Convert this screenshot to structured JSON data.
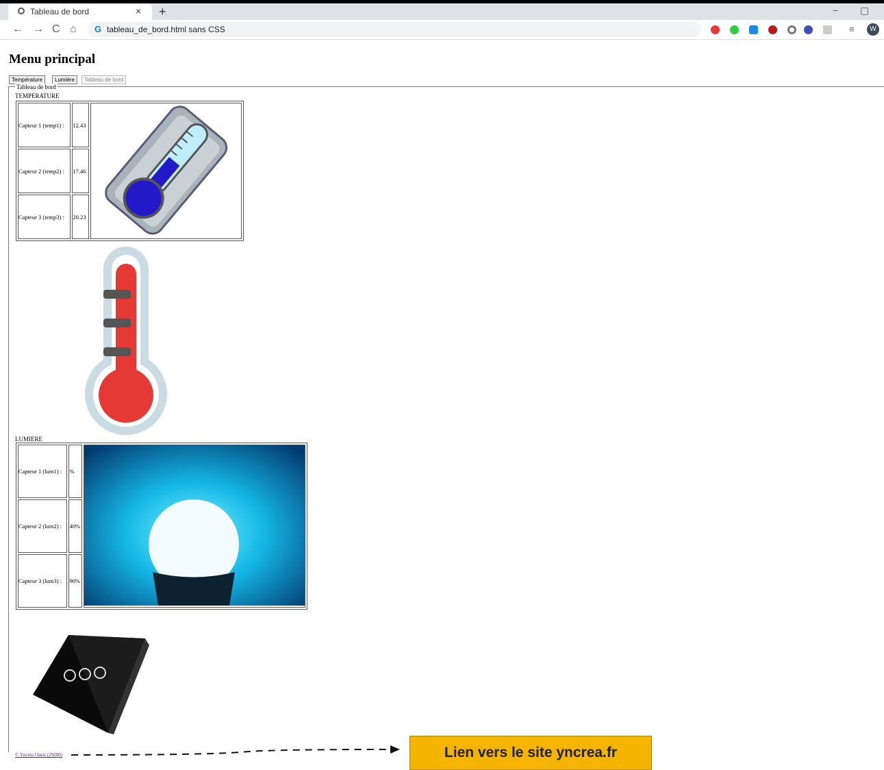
{
  "browser": {
    "tab_title": "Tableau de bord",
    "tab_close": "×",
    "new_tab": "+",
    "url": "tableau_de_bord.html sans CSS",
    "google_glyph": "G",
    "back": "←",
    "forward": "→",
    "reload": "C",
    "home": "⌂",
    "minimize": "−",
    "maximize": "▢",
    "profile_initial": "W",
    "extension_colors": [
      "#e53935",
      "#2ecc40",
      "#1e88e5",
      "#b71c1c",
      "#777777",
      "#3f51b5",
      "#bbbbbb"
    ]
  },
  "page": {
    "heading": "Menu principal",
    "buttons": [
      {
        "label": "Température",
        "disabled": false
      },
      {
        "label": "Lumière",
        "disabled": false
      },
      {
        "label": "Tableau de bord",
        "disabled": true
      }
    ],
    "legend": "Tableau de bord",
    "temperature": {
      "label": "TEMPERATURE",
      "rows": [
        {
          "sensor": "Capteur 1 (temp1) :",
          "value": "12.43"
        },
        {
          "sensor": "Capteur 2 (temp2) :",
          "value": "17.46"
        },
        {
          "sensor": "Capteur 3 (temp3) :",
          "value": "20.23"
        }
      ]
    },
    "lumiere": {
      "label": "LUMIERE",
      "rows": [
        {
          "sensor": "Capteur 1 (lum1) :",
          "value": "%"
        },
        {
          "sensor": "Capteur 2 (lum2) :",
          "value": "40%"
        },
        {
          "sensor": "Capteur 3 (lum3) :",
          "value": "90%"
        }
      ]
    },
    "footer_link": "© Yncréa Ouest (29200)",
    "callout": "Lien vers le site yncrea.fr"
  }
}
